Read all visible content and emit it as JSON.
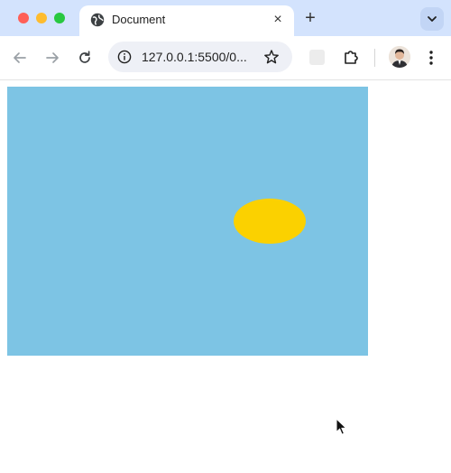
{
  "tab": {
    "title": "Document",
    "icon": "globe-icon",
    "close_label": "×"
  },
  "tabstrip": {
    "new_tab_label": "+",
    "tab_search_icon": "chevron-down-icon"
  },
  "toolbar": {
    "back_icon": "arrow-left-icon",
    "forward_icon": "arrow-right-icon",
    "reload_icon": "reload-icon",
    "url": "127.0.0.1:5500/0...",
    "site_info_icon": "info-icon",
    "bookmark_icon": "star-icon",
    "extensions_icon": "puzzle-icon",
    "menu_icon": "more-vertical-icon"
  },
  "scene": {
    "sky_color": "#7dc4e4",
    "sun_color": "#fbd100"
  },
  "colors": {
    "tabstrip_bg": "#d3e3fd",
    "omnibox_bg": "#eef0f6"
  }
}
